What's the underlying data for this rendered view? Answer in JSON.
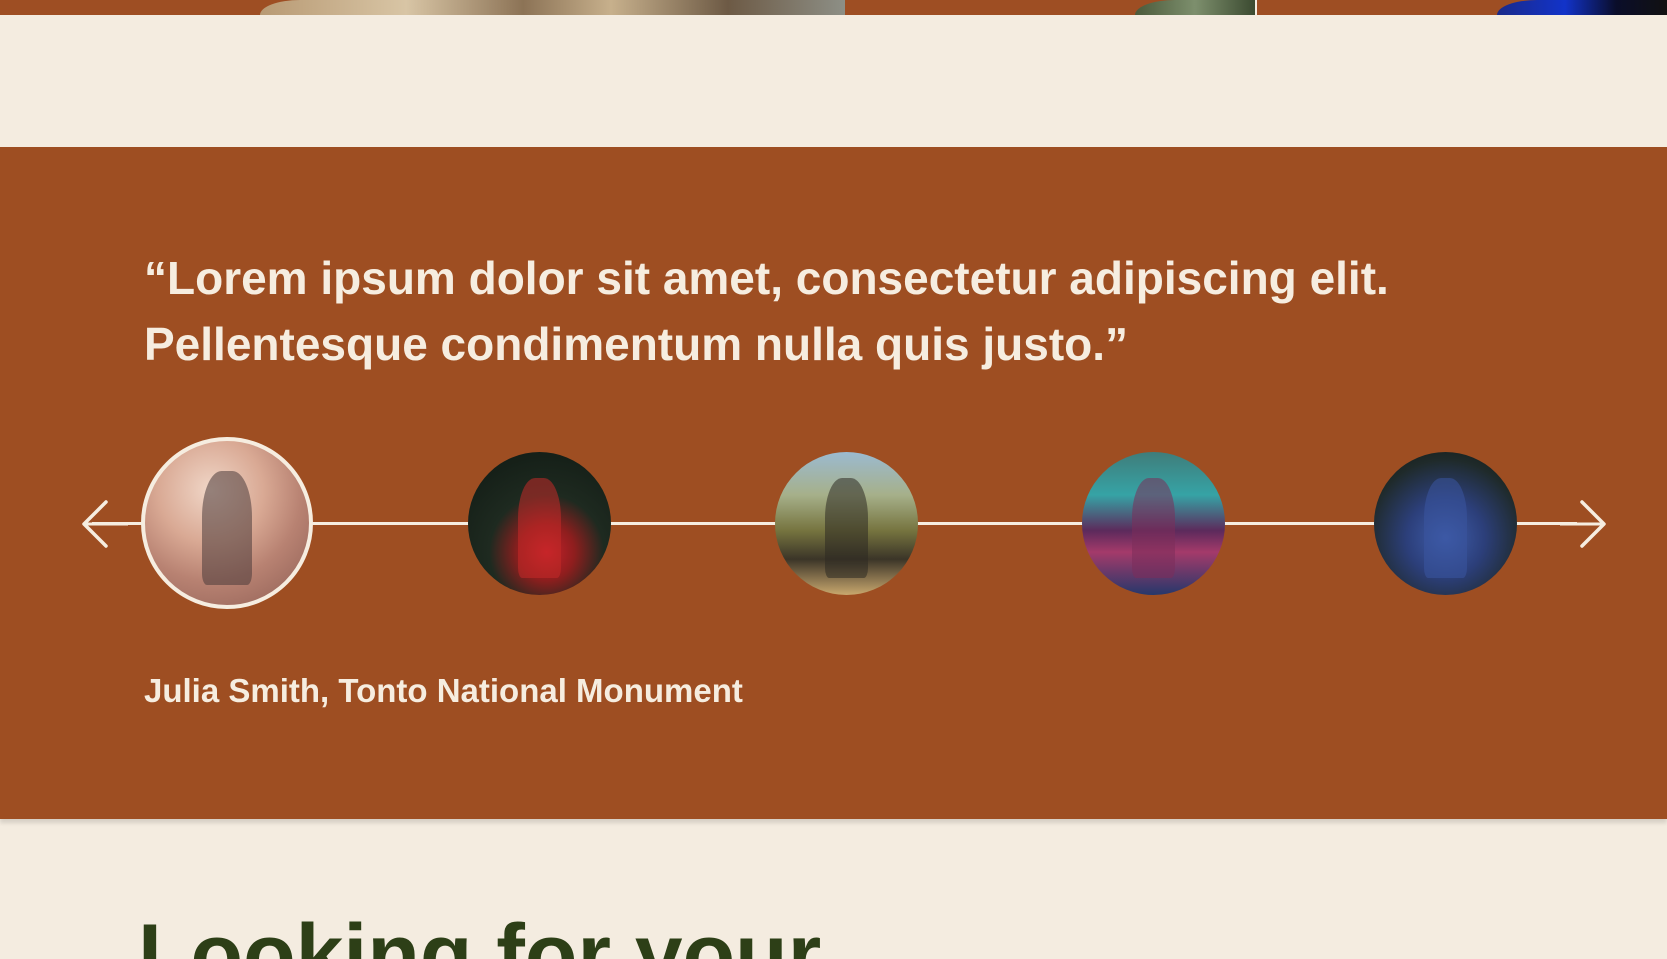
{
  "testimonial": {
    "quote": "“Lorem ipsum dolor sit amet, consectetur adipiscing elit. Pellentesque condimentum nulla quis justo.”",
    "person": "Julia Smith, Tonto National Monument",
    "nav": {
      "prev_icon": "arrow-left-icon",
      "next_icon": "arrow-right-icon"
    },
    "avatars": [
      {
        "name": "avatar-julia-smith",
        "active": true
      },
      {
        "name": "avatar-hiker-2",
        "active": false
      },
      {
        "name": "avatar-hiker-3",
        "active": false
      },
      {
        "name": "avatar-hiker-4",
        "active": false
      },
      {
        "name": "avatar-hiker-5",
        "active": false
      }
    ]
  },
  "next_section": {
    "heading": "Looking for your"
  },
  "colors": {
    "background": "#f4ece0",
    "band": "#9e4e22",
    "text_light": "#f6ede0",
    "heading_green": "#2d3f17"
  }
}
